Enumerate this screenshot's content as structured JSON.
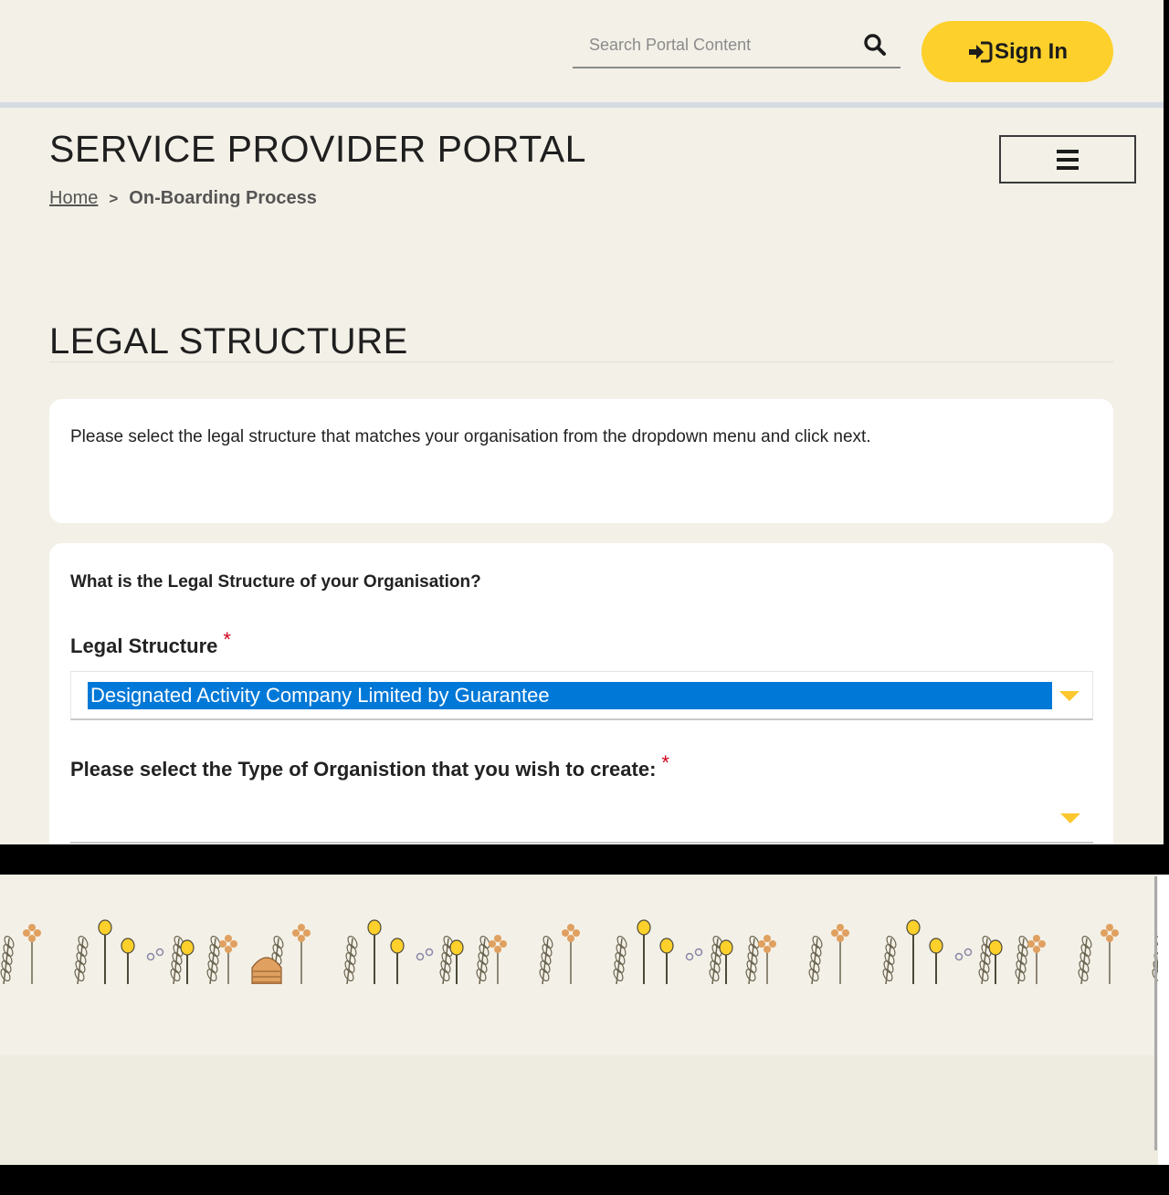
{
  "header": {
    "search": {
      "placeholder": "Search Portal Content",
      "icon": "search-icon"
    },
    "signin": {
      "label": "Sign In",
      "icon": "sign-in-icon"
    },
    "accent_color": "#fdd02b"
  },
  "portal": {
    "title": "SERVICE PROVIDER PORTAL",
    "menu_icon": "hamburger-menu-icon"
  },
  "breadcrumb": {
    "home": "Home",
    "separator": ">",
    "current": "On-Boarding Process"
  },
  "page": {
    "section_title": "LEGAL STRUCTURE",
    "intro": "Please select the legal structure that matches your organisation from the dropdown menu and click next."
  },
  "form": {
    "question": "What is the Legal Structure of your Organisation?",
    "legal_structure": {
      "label": "Legal Structure",
      "required_mark": "*",
      "value": "Designated Activity Company Limited by Guarantee"
    },
    "org_type": {
      "label": "Please select the Type of Organistion that you wish to create:",
      "required_mark": "*",
      "value": ""
    }
  },
  "footer": {
    "decoration": "floral-border-illustration"
  }
}
